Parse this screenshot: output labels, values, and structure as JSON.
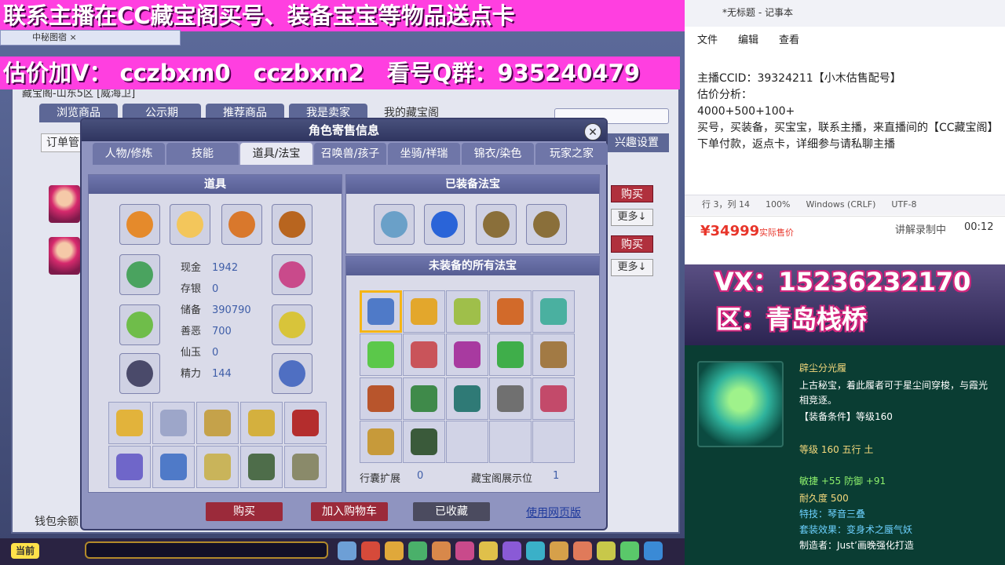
{
  "banner_top": "联系主播在CC藏宝阁买号、装备宝宝等物品送点卡",
  "banner_contact": "估价加V： cczbxm0　cczbxm2　看号Q群：935240479",
  "browser_tab": "中秘图宿  ×",
  "shop": {
    "subtitle": "藏宝阁-山东5区 [威海卫]",
    "tabs": [
      "浏览商品",
      "公示期",
      "推荐商品",
      "我是卖家",
      "我的藏宝阁"
    ],
    "order_btn": "订单管",
    "settings_btn": "兴趣设置",
    "buy": "购买",
    "more": "更多↓",
    "wallet": "钱包余额"
  },
  "dialog": {
    "title": "角色寄售信息",
    "close": "✕",
    "tabs": [
      "人物/修炼",
      "技能",
      "道具/法宝",
      "召唤兽/孩子",
      "坐骑/祥瑞",
      "锦衣/染色",
      "玩家之家"
    ],
    "items_head": "道具",
    "equipped_head": "已装备法宝",
    "unequipped_head": "未装备的所有法宝",
    "stats": [
      {
        "label": "现金",
        "value": "1942"
      },
      {
        "label": "存银",
        "value": "0"
      },
      {
        "label": "储备",
        "value": "390790"
      },
      {
        "label": "善恶",
        "value": "700"
      },
      {
        "label": "仙玉",
        "value": "0"
      },
      {
        "label": "精力",
        "value": "144"
      }
    ],
    "bag_expand_label": "行囊扩展",
    "bag_expand_value": "0",
    "display_label": "藏宝阁展示位",
    "display_value": "1",
    "btn_buy": "购买",
    "btn_cart": "加入购物车",
    "btn_fav": "已收藏",
    "btn_web": "使用网页版"
  },
  "game_bar": {
    "current": "当前"
  },
  "notepad": {
    "title": "*无标题 - 记事本",
    "menu": [
      "文件",
      "编辑",
      "查看"
    ],
    "lines": [
      "主播CCID：39324211【小木估售配号】",
      "估价分析：",
      "4000+500+100+",
      "买号，买装备，买宝宝，联系主播，来直播间的【CC藏宝阁】下单付款，返点卡，详细参与请私聊主播"
    ],
    "status": [
      "行 3，列 14",
      "100%",
      "Windows (CRLF)",
      "UTF-8"
    ]
  },
  "price": {
    "value": "¥34999",
    "note": "实际售价",
    "rec_label": "讲解录制中",
    "rec_time": "00:12"
  },
  "vx": {
    "line1": "VX：15236232170",
    "line2": "区：青岛栈桥"
  },
  "item": {
    "name": "辟尘分光履",
    "desc": "上古秘宝，着此履者可于星尘间穿梭，与霞光相竞逐。",
    "req": "【装备条件】等级160",
    "level": "等级 160 五行 土",
    "attr": "敏捷 +55 防御 +91",
    "dur": "耐久度 500",
    "skill": "特技：琴音三叠",
    "set": "套装效果：变身术之蜃气妖",
    "maker": "制造者：Just’画晚强化打造"
  },
  "colors": {
    "banner": "#ff3fe0",
    "buy": "#b0303d",
    "price": "#e8352a",
    "tooltip_bg": "#0a3d33"
  }
}
